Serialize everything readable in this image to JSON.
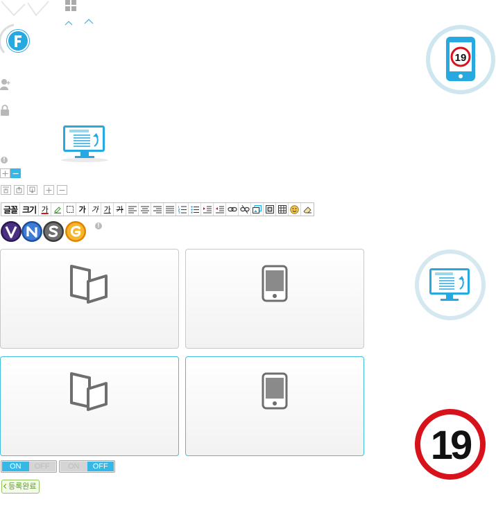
{
  "badges": {
    "age_rating": "19"
  },
  "editor": {
    "font_button": "글꼴",
    "size_button": "크기",
    "char_button": "가"
  },
  "view_toggle_a": {
    "on": "ON",
    "off": "OFF",
    "selected": "ON"
  },
  "view_toggle_b": {
    "on": "ON",
    "off": "OFF",
    "selected": "OFF"
  },
  "actions": {
    "complete": "등록완료"
  },
  "colors": {
    "accent": "#36b8e6",
    "card_active_border": "#3fbfdc",
    "rating_red": "#d8121b",
    "complete_green": "#5c9a2b"
  },
  "icons": {
    "logo": "f-logo-icon",
    "badges": [
      "v-badge-icon",
      "n-badge-icon",
      "s-badge-icon",
      "g-badge-icon"
    ]
  }
}
